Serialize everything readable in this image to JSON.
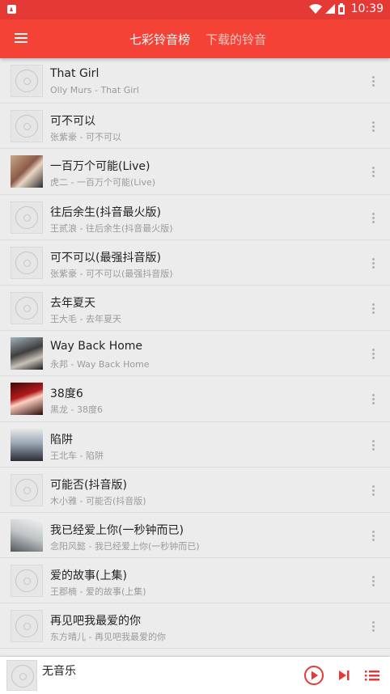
{
  "status_bar": {
    "time": "10:39"
  },
  "app_bar": {
    "menu_icon": "hamburger-menu-icon",
    "tabs": [
      {
        "label": "七彩铃音榜",
        "active": true
      },
      {
        "label": "下载的铃音",
        "active": false
      }
    ],
    "color": "#f44336"
  },
  "songs": [
    {
      "title": "That Girl",
      "subtitle": "Olly Murs - That Girl",
      "cover": "placeholder"
    },
    {
      "title": "可不可以",
      "subtitle": "张紫豪 - 可不可以",
      "cover": "placeholder"
    },
    {
      "title": "一百万个可能(Live)",
      "subtitle": "虎二 - 一百万个可能(Live)",
      "cover": "photo"
    },
    {
      "title": "往后余生(抖音最火版)",
      "subtitle": "王贰浪 - 往后余生(抖音最火版)",
      "cover": "placeholder"
    },
    {
      "title": "可不可以(最强抖音版)",
      "subtitle": "张紫豪 - 可不可以(最强抖音版)",
      "cover": "placeholder"
    },
    {
      "title": "去年夏天",
      "subtitle": "王大毛 - 去年夏天",
      "cover": "placeholder"
    },
    {
      "title": "Way Back Home",
      "subtitle": "永邦 - Way Back Home",
      "cover": "photo"
    },
    {
      "title": "38度6",
      "subtitle": "黑龙 - 38度6",
      "cover": "photo"
    },
    {
      "title": "陷阱",
      "subtitle": "王北车 - 陷阱",
      "cover": "photo"
    },
    {
      "title": "可能否(抖音版)",
      "subtitle": "木小雅 - 可能否(抖音版)",
      "cover": "placeholder"
    },
    {
      "title": "我已经爱上你(一秒钟而已)",
      "subtitle": "念阳风懿 - 我已经爱上你(一秒钟而已)",
      "cover": "photo"
    },
    {
      "title": "爱的故事(上集)",
      "subtitle": "王郡楠 - 爱的故事(上集)",
      "cover": "placeholder"
    },
    {
      "title": "再见吧我最爱的你",
      "subtitle": "东方晴儿 - 再见吧我最爱的你",
      "cover": "placeholder"
    }
  ],
  "player": {
    "now_playing": "无音乐",
    "cover": "placeholder",
    "controls": [
      "play-circle-icon",
      "skip-next-icon",
      "queue-list-icon"
    ],
    "accent": "#e53935"
  }
}
